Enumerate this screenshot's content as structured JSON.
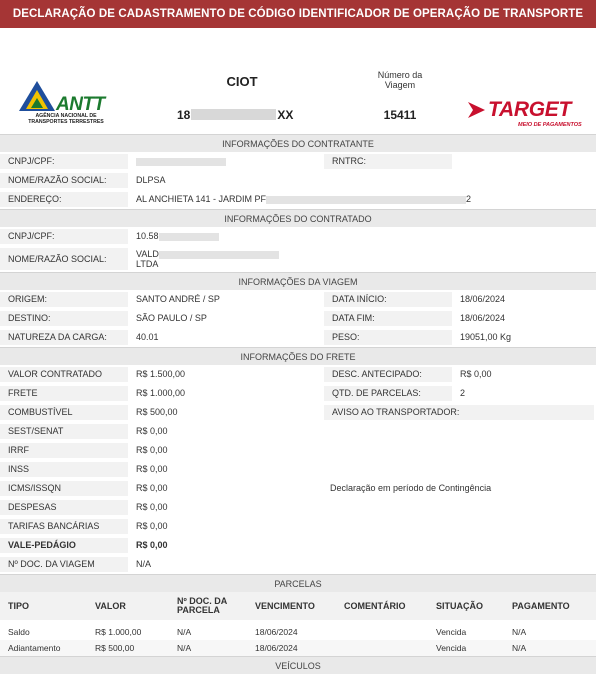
{
  "title": "DECLARAÇÃO DE CADASTRAMENTO DE CÓDIGO IDENTIFICADOR DE OPERAÇÃO DE TRANSPORTE",
  "header": {
    "antt_logo_text": "ANTT",
    "antt_subtitle_line1": "AGÊNCIA NACIONAL DE",
    "antt_subtitle_line2": "TRANSPORTES TERRESTRES",
    "ciot_label": "CIOT",
    "ciot_prefix": "18",
    "ciot_suffix": "XX",
    "viagem_label": "Número da Viagem",
    "viagem_value": "15411",
    "target_logo_text": "TARGET",
    "target_subtitle": "MEIO DE PAGAMENTOS"
  },
  "contratante": {
    "section": "INFORMAÇÕES DO CONTRATANTE",
    "cnpj_label": "CNPJ/CPF:",
    "cnpj_value": "",
    "rntrc_label": "RNTRC:",
    "rntrc_value": "",
    "nome_label": "NOME/RAZÃO SOCIAL:",
    "nome_value": "DLPSA",
    "endereco_label": "ENDEREÇO:",
    "endereco_value": "AL ANCHIETA 141 - JARDIM PF",
    "endereco_tail": "2"
  },
  "contratado": {
    "section": "INFORMAÇÕES DO CONTRATADO",
    "cnpj_label": "CNPJ/CPF:",
    "cnpj_value": "10.58",
    "nome_label": "NOME/RAZÃO SOCIAL:",
    "nome_value_line1": "VALD",
    "nome_value_line2": "LTDA"
  },
  "viagem": {
    "section": "INFORMAÇÕES DA VIAGEM",
    "origem_label": "ORIGEM:",
    "origem_value": "SANTO ANDRÉ / SP",
    "data_inicio_label": "DATA INÍCIO:",
    "data_inicio_value": "18/06/2024",
    "destino_label": "DESTINO:",
    "destino_value": "SÃO PAULO / SP",
    "data_fim_label": "DATA FIM:",
    "data_fim_value": "18/06/2024",
    "natureza_label": "NATUREZA DA CARGA:",
    "natureza_value": "40.01",
    "peso_label": "PESO:",
    "peso_value": "19051,00 Kg"
  },
  "frete": {
    "section": "INFORMAÇÕES DO FRETE",
    "items": [
      {
        "label": "VALOR CONTRATADO",
        "value": "R$ 1.500,00"
      },
      {
        "label": "FRETE",
        "value": "R$ 1.000,00"
      },
      {
        "label": "COMBUSTÍVEL",
        "value": "R$ 500,00"
      },
      {
        "label": "SEST/SENAT",
        "value": "R$ 0,00"
      },
      {
        "label": "IRRF",
        "value": "R$ 0,00"
      },
      {
        "label": "INSS",
        "value": "R$ 0,00"
      },
      {
        "label": "ICMS/ISSQN",
        "value": "R$ 0,00"
      },
      {
        "label": "DESPESAS",
        "value": "R$ 0,00"
      },
      {
        "label": "TARIFAS BANCÁRIAS",
        "value": "R$ 0,00"
      },
      {
        "label": "VALE-PEDÁGIO",
        "value": "R$ 0,00"
      },
      {
        "label": "Nº DOC. DA VIAGEM",
        "value": "N/A"
      }
    ],
    "desc_antecipado_label": "DESC. ANTECIPADO:",
    "desc_antecipado_value": "R$ 0,00",
    "qtd_parcelas_label": "QTD. DE PARCELAS:",
    "qtd_parcelas_value": "2",
    "aviso_label": "AVISO AO TRANSPORTADOR:",
    "contingencia_text": "Declaração em período de Contingência"
  },
  "parcelas": {
    "section": "PARCELAS",
    "headers": {
      "tipo": "TIPO",
      "valor": "VALOR",
      "doc_line1": "Nº DOC. DA",
      "doc_line2": "PARCELA",
      "vencimento": "VENCIMENTO",
      "comentario": "COMENTÁRIO",
      "situacao": "SITUAÇÃO",
      "pagamento": "PAGAMENTO"
    },
    "rows": [
      {
        "tipo": "Saldo",
        "valor": "R$ 1.000,00",
        "doc": "N/A",
        "vencimento": "18/06/2024",
        "comentario": "",
        "situacao": "Vencida",
        "pagamento": "N/A"
      },
      {
        "tipo": "Adiantamento",
        "valor": "R$ 500,00",
        "doc": "N/A",
        "vencimento": "18/06/2024",
        "comentario": "",
        "situacao": "Vencida",
        "pagamento": "N/A"
      }
    ]
  },
  "veiculos": {
    "section": "VEÍCULOS"
  },
  "colors": {
    "title_bar": "#a53535",
    "section_bg": "#e9e9e9",
    "label_bg": "#f2f2f2",
    "antt_green": "#1b7a2e",
    "antt_blue": "#1f4e9c",
    "antt_yellow": "#f2c200",
    "target_red": "#c8102e"
  }
}
